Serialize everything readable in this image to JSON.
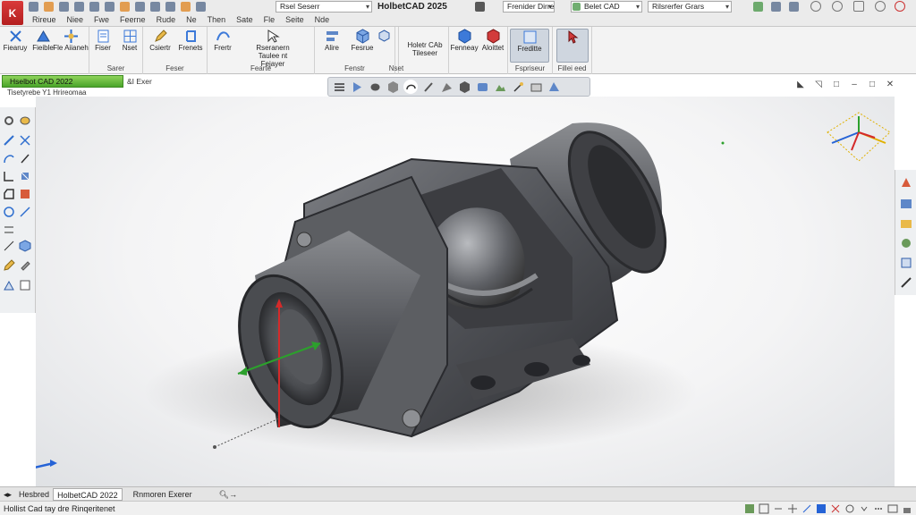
{
  "app": {
    "logo_letter": "K"
  },
  "title_bar": {
    "search_dropdown": "Rsel Seserr",
    "app_title": "HolbetCAD 2025",
    "right_dropdown_1": "Frenider Dirre",
    "part_dropdown": "Belet CAD",
    "right_dropdown_2": "Rilsrerfer Grars"
  },
  "menus": [
    "Rireue",
    "Niee",
    "Fwe",
    "Feerne",
    "Rude",
    "Ne",
    "Then",
    "Sate",
    "Fle",
    "Seite",
    "Nde"
  ],
  "ribbon": {
    "groups": [
      {
        "label": "",
        "tools": [
          "Fiearuy",
          "Fieible",
          "Fle Aiianeh"
        ]
      },
      {
        "label": "Sarer",
        "tools": [
          "Fiser",
          "Nset"
        ]
      },
      {
        "label": "Feser",
        "tools": [
          "Csiertr",
          "Frenets"
        ]
      },
      {
        "label": "Fearte",
        "tools": [
          "Frertr",
          "Rseranern Taulee nt Fejayer"
        ]
      },
      {
        "label": "Fenstr",
        "tools": [
          "Alire",
          "Fesrue"
        ]
      },
      {
        "label": "Nset",
        "tools": []
      },
      {
        "label": "",
        "tools": [
          "Holetr CAb Tileseer"
        ]
      },
      {
        "label": "",
        "tools": [
          "Fenneay",
          "Aloittet"
        ]
      },
      {
        "label": "Fspriseur",
        "tools": [
          "Freditte"
        ]
      },
      {
        "label": "Fillei eed",
        "tools": []
      }
    ]
  },
  "document": {
    "tab_label": "Hselbot CAD 2022",
    "tab_label_2": "&I Exer",
    "sub_label": "Tisetyrebe Y1 Hrireomaa"
  },
  "bottom_tabs": [
    "Hesbred",
    "HolbetCAD 2022",
    "Rnmoren Exerer"
  ],
  "status": {
    "text": "Hollist Cad tay dre Rinqeritenet"
  },
  "colors": {
    "accent_green": "#5bb830",
    "axis_x": "#d42a2a",
    "axis_y": "#2ca02c",
    "axis_z": "#2563d6",
    "model_grey": "#5a5c60"
  }
}
